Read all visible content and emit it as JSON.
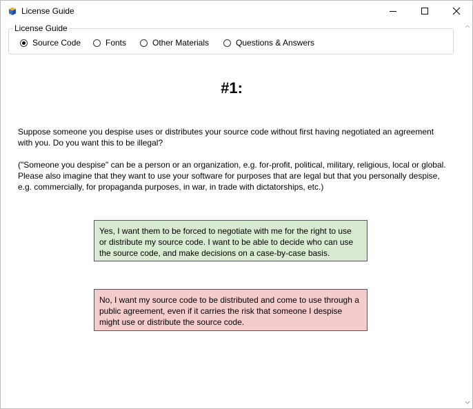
{
  "window": {
    "title": "License Guide",
    "icon": "app-box-icon"
  },
  "group": {
    "legend": "License Guide",
    "options": [
      {
        "label": "Source Code",
        "checked": true
      },
      {
        "label": "Fonts",
        "checked": false
      },
      {
        "label": "Other Materials",
        "checked": false
      },
      {
        "label": "Questions & Answers",
        "checked": false
      }
    ]
  },
  "content": {
    "heading": "#1:",
    "question": "Suppose someone you despise uses or distributes your source code without first having negotiated an agreement\nwith you. Do you want this to be illegal?",
    "note": "(\"Someone you despise\" can be a person or an organization, e.g. for-profit, political, military, religious, local or global.\nPlease also imagine that they want to use your software for purposes that are legal but that you personally despise,\ne.g. commercially, for propaganda purposes, in war, in trade with dictatorships, etc.)",
    "answers": {
      "yes": "Yes, I want them to be forced to negotiate with me for the right to use or distribute my source code. I want to be able to decide who can use the source code, and make decisions on a case-by-case basis.",
      "no": "No, I want my source code to be distributed and come to use through a public agreement, even if it carries the risk that someone I despise might use or distribute the source code."
    },
    "colors": {
      "yes_bg": "#d9ead3",
      "no_bg": "#f4cccc"
    }
  }
}
